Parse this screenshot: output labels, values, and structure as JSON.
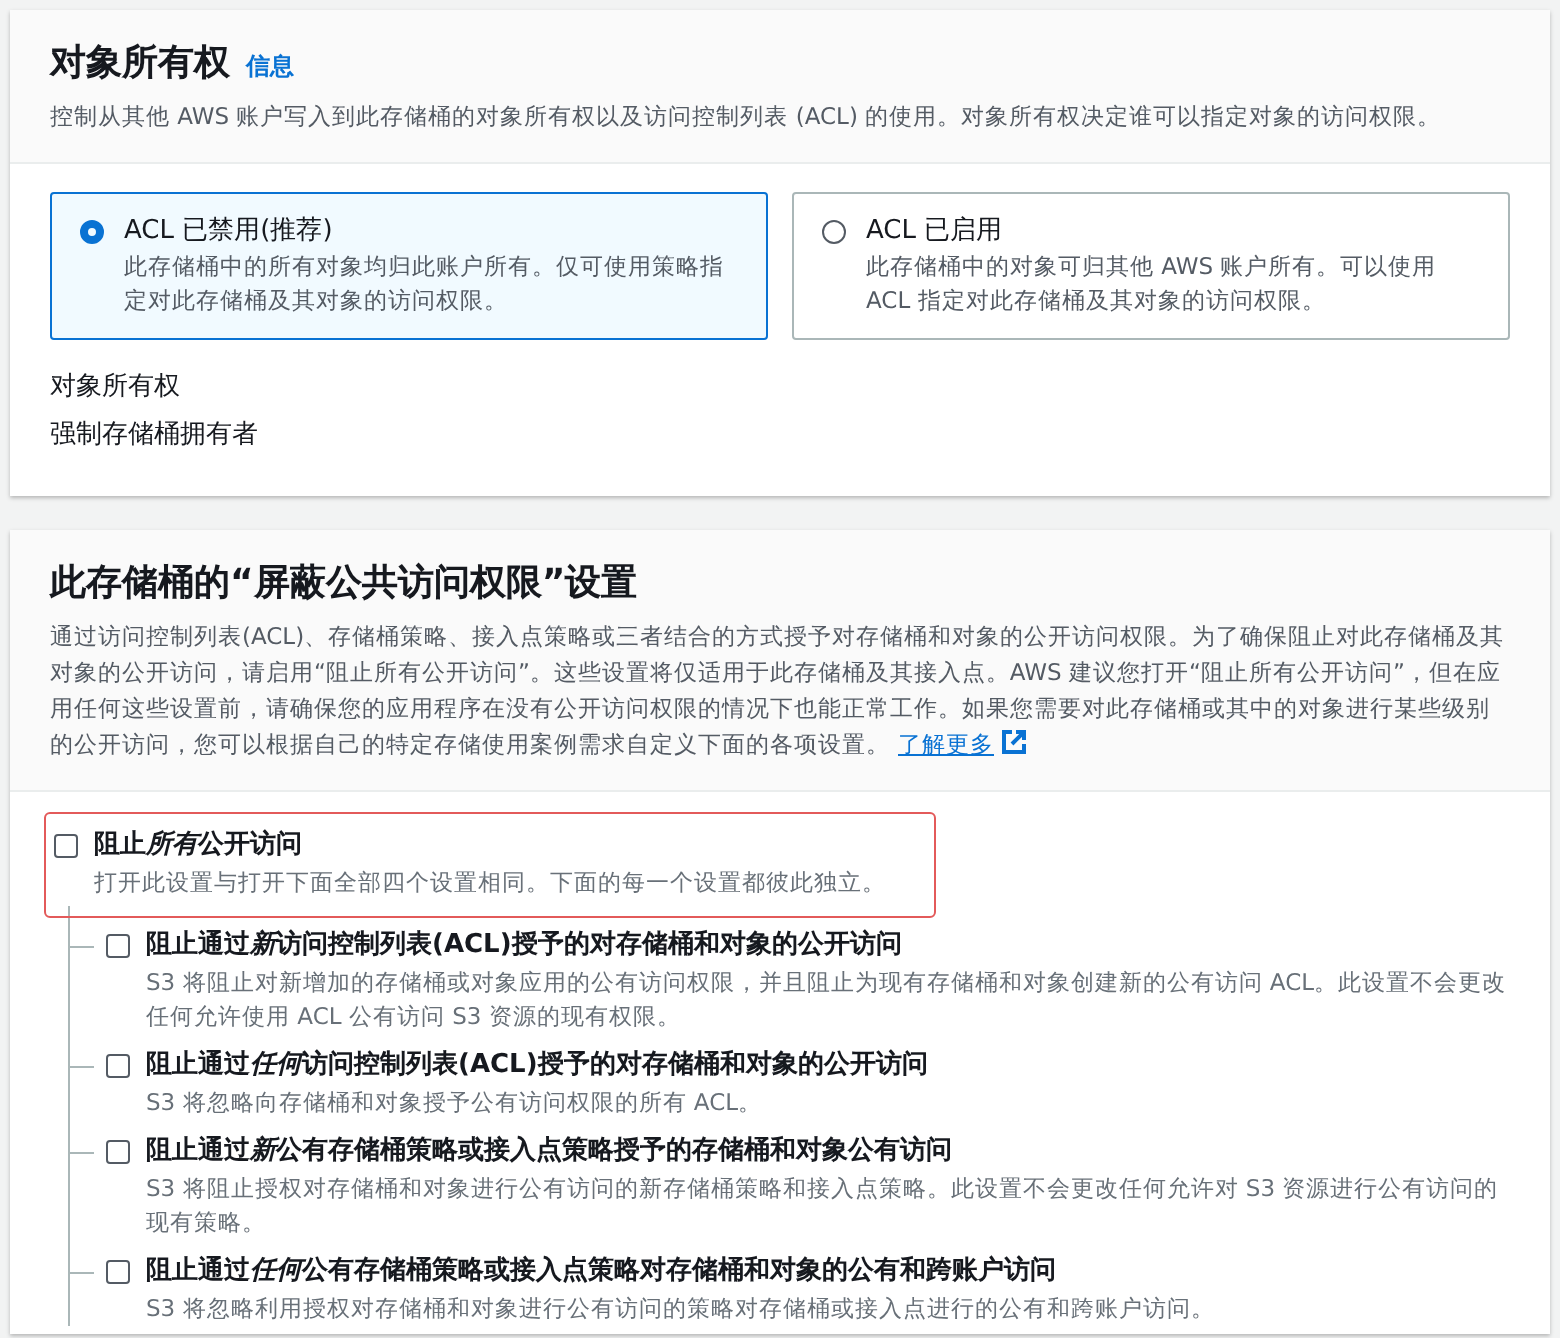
{
  "ownership": {
    "title": "对象所有权",
    "info_link": "信息",
    "description": "控制从其他 AWS 账户写入到此存储桶的对象所有权以及访问控制列表 (ACL) 的使用。对象所有权决定谁可以指定对象的访问权限。",
    "options": [
      {
        "label": "ACL 已禁用(推荐)",
        "description": "此存储桶中的所有对象均归此账户所有。仅可使用策略指定对此存储桶及其对象的访问权限。",
        "selected": true
      },
      {
        "label": "ACL 已启用",
        "description": "此存储桶中的对象可归其他 AWS 账户所有。可以使用 ACL 指定对此存储桶及其对象的访问权限。",
        "selected": false
      }
    ],
    "field_label": "对象所有权",
    "field_value": "强制存储桶拥有者"
  },
  "block_public_access": {
    "title": "此存储桶的“屏蔽公共访问权限”设置",
    "description": "通过访问控制列表(ACL)、存储桶策略、接入点策略或三者结合的方式授予对存储桶和对象的公开访问权限。为了确保阻止对此存储桶及其对象的公开访问，请启用“阻止所有公开访问”。这些设置将仅适用于此存储桶及其接入点。AWS 建议您打开“阻止所有公开访问”，但在应用任何这些设置前，请确保您的应用程序在没有公开访问权限的情况下也能正常工作。如果您需要对此存储桶或其中的对象进行某些级别的公开访问，您可以根据自己的特定存储使用案例需求自定义下面的各项设置。",
    "learn_more": "了解更多",
    "master": {
      "label": [
        "阻止",
        "所有",
        "公开访问"
      ],
      "description": "打开此设置与打开下面全部四个设置相同。下面的每一个设置都彼此独立。",
      "checked": false,
      "highlighted": true
    },
    "settings": [
      {
        "label": [
          "阻止通过",
          "新",
          "访问控制列表(ACL)授予的对存储桶和对象的公开访问"
        ],
        "description": "S3 将阻止对新增加的存储桶或对象应用的公有访问权限，并且阻止为现有存储桶和对象创建新的公有访问 ACL。此设置不会更改任何允许使用 ACL 公有访问 S3 资源的现有权限。",
        "checked": false
      },
      {
        "label": [
          "阻止通过",
          "任何",
          "访问控制列表(ACL)授予的对存储桶和对象的公开访问"
        ],
        "description": "S3 将忽略向存储桶和对象授予公有访问权限的所有 ACL。",
        "checked": false
      },
      {
        "label": [
          "阻止通过",
          "新",
          "公有存储桶策略或接入点策略授予的存储桶和对象公有访问"
        ],
        "description": "S3 将阻止授权对存储桶和对象进行公有访问的新存储桶策略和接入点策略。此设置不会更改任何允许对 S3 资源进行公有访问的现有策略。",
        "checked": false
      },
      {
        "label": [
          "阻止通过",
          "任何",
          "公有存储桶策略或接入点策略对存储桶和对象的公有和跨账户访问"
        ],
        "description": "S3 将忽略利用授权对存储桶和对象进行公有访问的策略对存储桶或接入点进行的公有和跨账户访问。",
        "checked": false
      }
    ]
  }
}
